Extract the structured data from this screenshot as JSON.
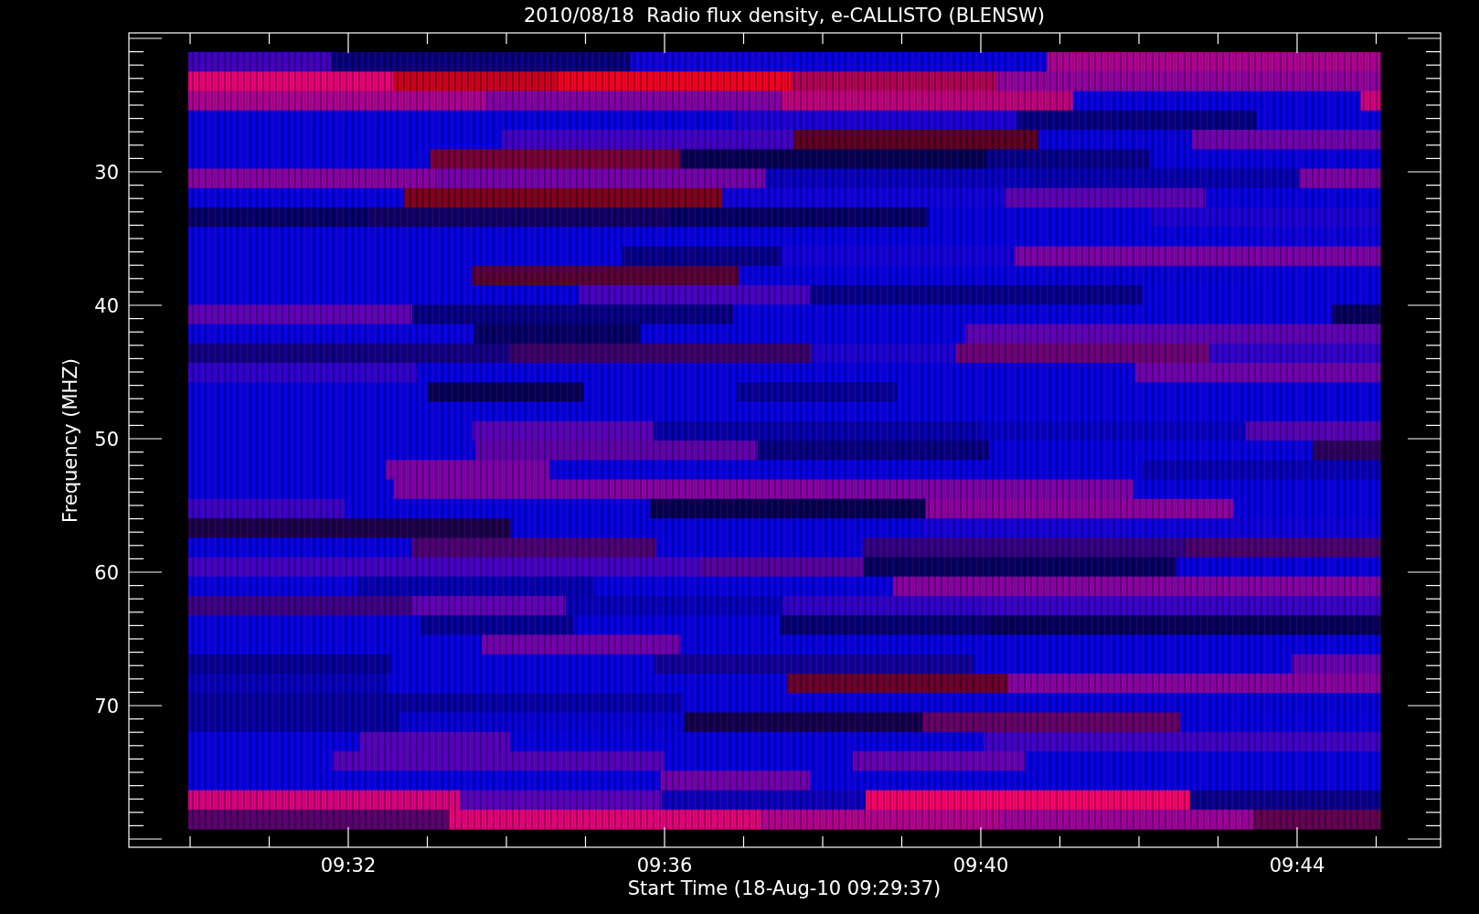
{
  "plot": {
    "title": "2010/08/18  Radio flux density, e-CALLISTO (BLENSW)",
    "ylabel": "Frequency (MHZ)",
    "xlabel": "Start Time (18-Aug-10 09:29:37)",
    "yticks": [
      "30",
      "40",
      "50",
      "60",
      "70"
    ],
    "xticks": [
      "09:32",
      "09:36",
      "09:40",
      "09:44"
    ]
  }
}
